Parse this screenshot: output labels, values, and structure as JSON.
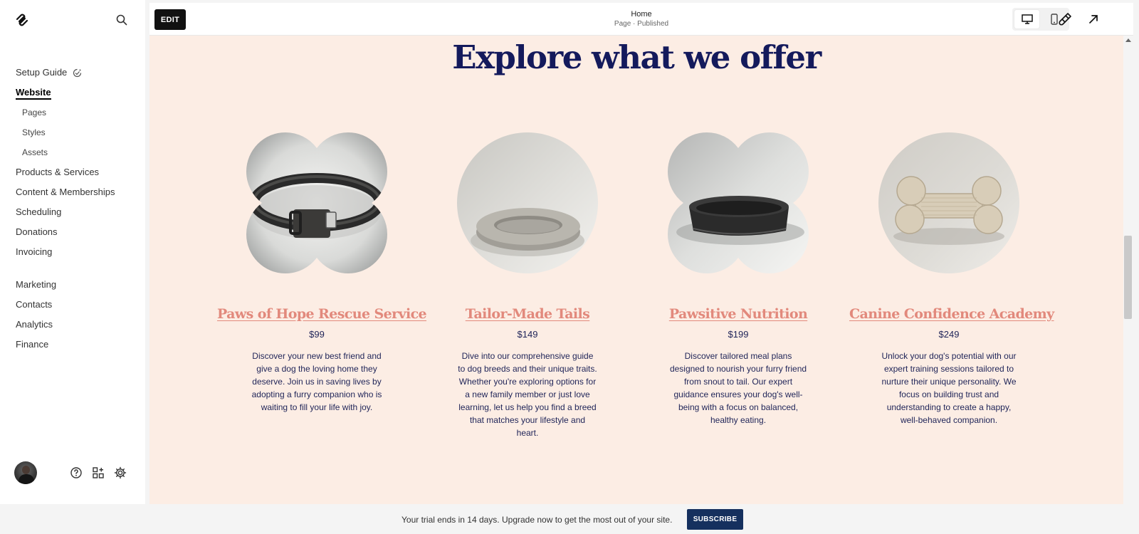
{
  "sidebar": {
    "nav": [
      {
        "label": "Setup Guide",
        "active": false
      },
      {
        "label": "Website",
        "active": true
      },
      {
        "label": "Pages",
        "sub": true
      },
      {
        "label": "Styles",
        "sub": true
      },
      {
        "label": "Assets",
        "sub": true
      },
      {
        "label": "Products & Services"
      },
      {
        "label": "Content & Memberships"
      },
      {
        "label": "Scheduling"
      },
      {
        "label": "Donations"
      },
      {
        "label": "Invoicing"
      },
      {
        "label": "Marketing"
      },
      {
        "label": "Contacts"
      },
      {
        "label": "Analytics"
      },
      {
        "label": "Finance"
      }
    ]
  },
  "topbar": {
    "edit_label": "EDIT",
    "page_title": "Home",
    "page_status": "Page · Published"
  },
  "content": {
    "section_title": "Explore what we offer",
    "cards": [
      {
        "title": "Paws of Hope Rescue Service",
        "price": "$99",
        "description": "Discover your new best friend and give a dog the loving home they deserve. Join us in saving lives by adopting a furry companion who is waiting to fill your life with joy.",
        "image": "dog-collar",
        "shape": "quatrefoil"
      },
      {
        "title": "Tailor-Made Tails",
        "price": "$149",
        "description": "Dive into our comprehensive guide to dog breeds and their unique traits. Whether you're exploring options for a new family member or just love learning, let us help you find a breed that matches your lifestyle and heart.",
        "image": "dog-bed",
        "shape": "circle"
      },
      {
        "title": "Pawsitive Nutrition",
        "price": "$199",
        "description": "Discover tailored meal plans designed to nourish your furry friend from snout to tail. Our expert guidance ensures your dog's well-being with a focus on balanced, healthy eating.",
        "image": "dog-bowl",
        "shape": "quatrefoil"
      },
      {
        "title": "Canine Confidence Academy",
        "price": "$249",
        "description": "Unlock your dog's potential with our expert training sessions tailored to nurture their unique personality. We focus on building trust and understanding to create a happy, well-behaved companion.",
        "image": "bone-toy",
        "shape": "circle"
      }
    ]
  },
  "trial": {
    "message": "Your trial ends in 14 days. Upgrade now to get the most out of your site.",
    "subscribe_label": "SUBSCRIBE"
  },
  "colors": {
    "canvas_bg": "#fcede4",
    "heading": "#141a5c",
    "card_title": "#e2897c",
    "body_text": "#1f2458",
    "subscribe_bg": "#15305e"
  }
}
